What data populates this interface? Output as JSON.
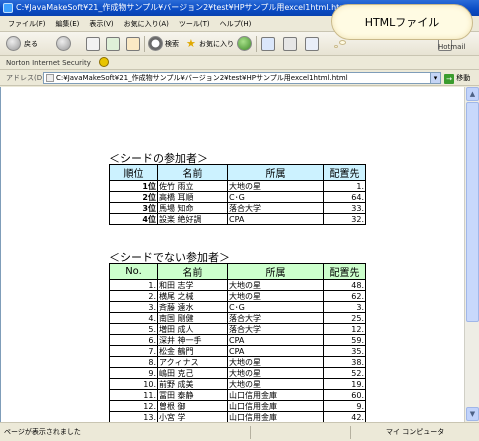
{
  "window": {
    "title": "C:¥JavaMakeSoft¥21_作成物サンプル¥バージョン2¥test¥HPサンプル用excel1html.html - M"
  },
  "menu": [
    "ファイル(F)",
    "編集(E)",
    "表示(V)",
    "お気に入り(A)",
    "ツール(T)",
    "ヘルプ(H)"
  ],
  "toolbar": {
    "back": "戻る",
    "search": "検索",
    "favorites": "お気に入り",
    "hotmail": "Hotmail"
  },
  "norton": {
    "label": "Norton Internet Security"
  },
  "address": {
    "label": "アドレス(D)",
    "url": "C:¥JavaMakeSoft¥21_作成物サンプル¥バージョン2¥test¥HPサンプル用excel1html.html",
    "go": "移動"
  },
  "callout": {
    "text": "HTMLファイル"
  },
  "seeded": {
    "title": "＜シードの参加者＞",
    "headers": [
      "順位",
      "名前",
      "所属",
      "配置先"
    ],
    "rows": [
      [
        "1位",
        "佐竹 雨立",
        "大地の星",
        "1."
      ],
      [
        "2位",
        "高橋 耳順",
        "C･G",
        "64."
      ],
      [
        "3位",
        "馬場 知命",
        "落合大学",
        "33."
      ],
      [
        "4位",
        "設楽 絶好調",
        "CPA",
        "32."
      ]
    ]
  },
  "unseeded": {
    "title": "＜シードでない参加者＞",
    "headers": [
      "No.",
      "名前",
      "所属",
      "配置先"
    ],
    "rows": [
      [
        "1.",
        "和田 志学",
        "大地の星",
        "48."
      ],
      [
        "2.",
        "横尾 之械",
        "大地の星",
        "62."
      ],
      [
        "3.",
        "斉藤 遠水",
        "C･G",
        "3."
      ],
      [
        "4.",
        "南国 剛健",
        "落合大学",
        "25."
      ],
      [
        "5.",
        "増田 成人",
        "落合大学",
        "12."
      ],
      [
        "6.",
        "深井 神一手",
        "CPA",
        "59."
      ],
      [
        "7.",
        "松金 鶴門",
        "CPA",
        "35."
      ],
      [
        "8.",
        "アクィナス",
        "大地の星",
        "38."
      ],
      [
        "9.",
        "嶋田 克己",
        "大地の星",
        "52."
      ],
      [
        "10.",
        "前野 成美",
        "大地の星",
        "19."
      ],
      [
        "11.",
        "冨田 泰静",
        "山口信用金庫",
        "60."
      ],
      [
        "12.",
        "曽根 御",
        "山口信用金庫",
        "9."
      ],
      [
        "13.",
        "小宮 学",
        "山口信用金庫",
        "42."
      ]
    ]
  },
  "status": {
    "left": "ページが表示されました",
    "right": "マイ コンピュータ"
  }
}
